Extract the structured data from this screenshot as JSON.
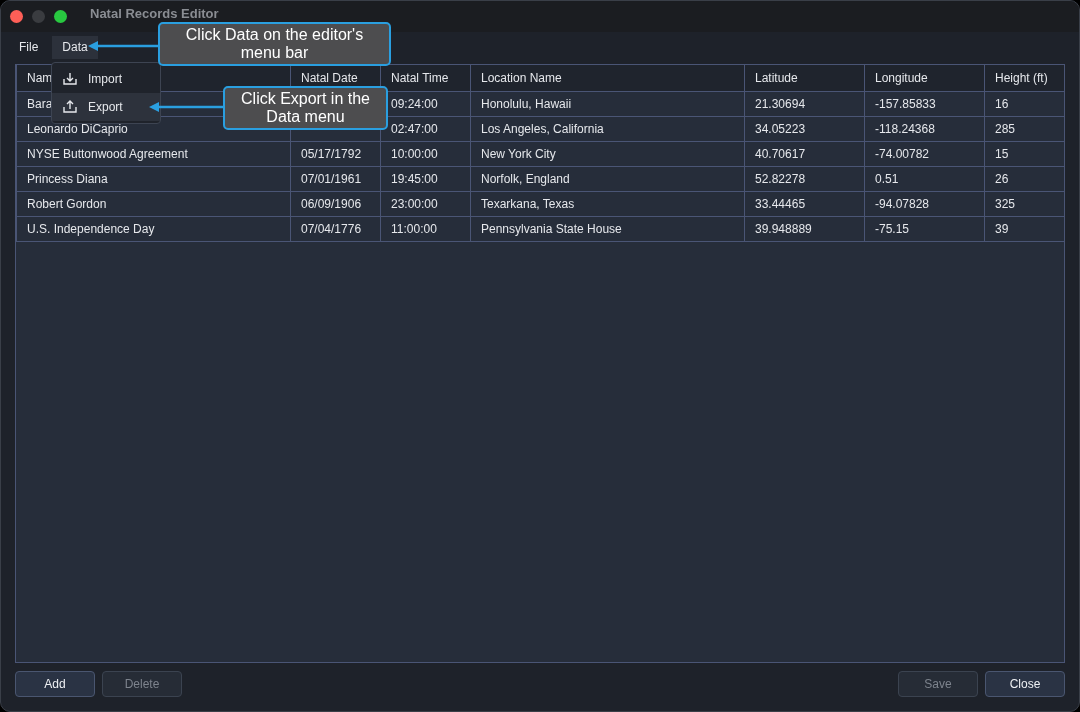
{
  "window": {
    "title": "Natal Records Editor"
  },
  "menu_bar": [
    {
      "label": "File",
      "selected": false
    },
    {
      "label": "Data",
      "selected": true
    }
  ],
  "data_menu": [
    {
      "kind": "import",
      "label": "Import",
      "selected": false
    },
    {
      "kind": "export",
      "label": "Export",
      "selected": true
    }
  ],
  "table": {
    "columns": [
      "Nam",
      "Natal Date",
      "Natal Time",
      "Location Name",
      "Latitude",
      "Longitude",
      "Height (ft)"
    ],
    "rows": [
      [
        "Bara",
        null,
        "09:24:00",
        "Honolulu, Hawaii",
        "21.30694",
        "-157.85833",
        "16"
      ],
      [
        "Leonardo DiCaprio",
        null,
        "02:47:00",
        "Los Angeles, California",
        "34.05223",
        "-118.24368",
        "285"
      ],
      [
        "NYSE Buttonwood Agreement",
        "05/17/1792",
        "10:00:00",
        "New York City",
        "40.70617",
        "-74.00782",
        "15"
      ],
      [
        "Princess Diana",
        "07/01/1961",
        "19:45:00",
        "Norfolk, England",
        "52.82278",
        "0.51",
        "26"
      ],
      [
        "Robert Gordon",
        "06/09/1906",
        "23:00:00",
        "Texarkana, Texas",
        "33.44465",
        "-94.07828",
        "325"
      ],
      [
        "U.S. Independence Day",
        "07/04/1776",
        "11:00:00",
        "Pennsylvania State House",
        "39.948889",
        "-75.15",
        "39"
      ]
    ]
  },
  "buttons_left": [
    {
      "label": "Add",
      "disabled": false
    },
    {
      "label": "Delete",
      "disabled": true
    }
  ],
  "buttons_right": [
    {
      "label": "Save",
      "disabled": true
    },
    {
      "label": "Close",
      "disabled": false
    }
  ],
  "callouts": [
    {
      "text": "Click Data on the editor's menu bar"
    },
    {
      "text": "Click Export in the Data menu"
    }
  ]
}
